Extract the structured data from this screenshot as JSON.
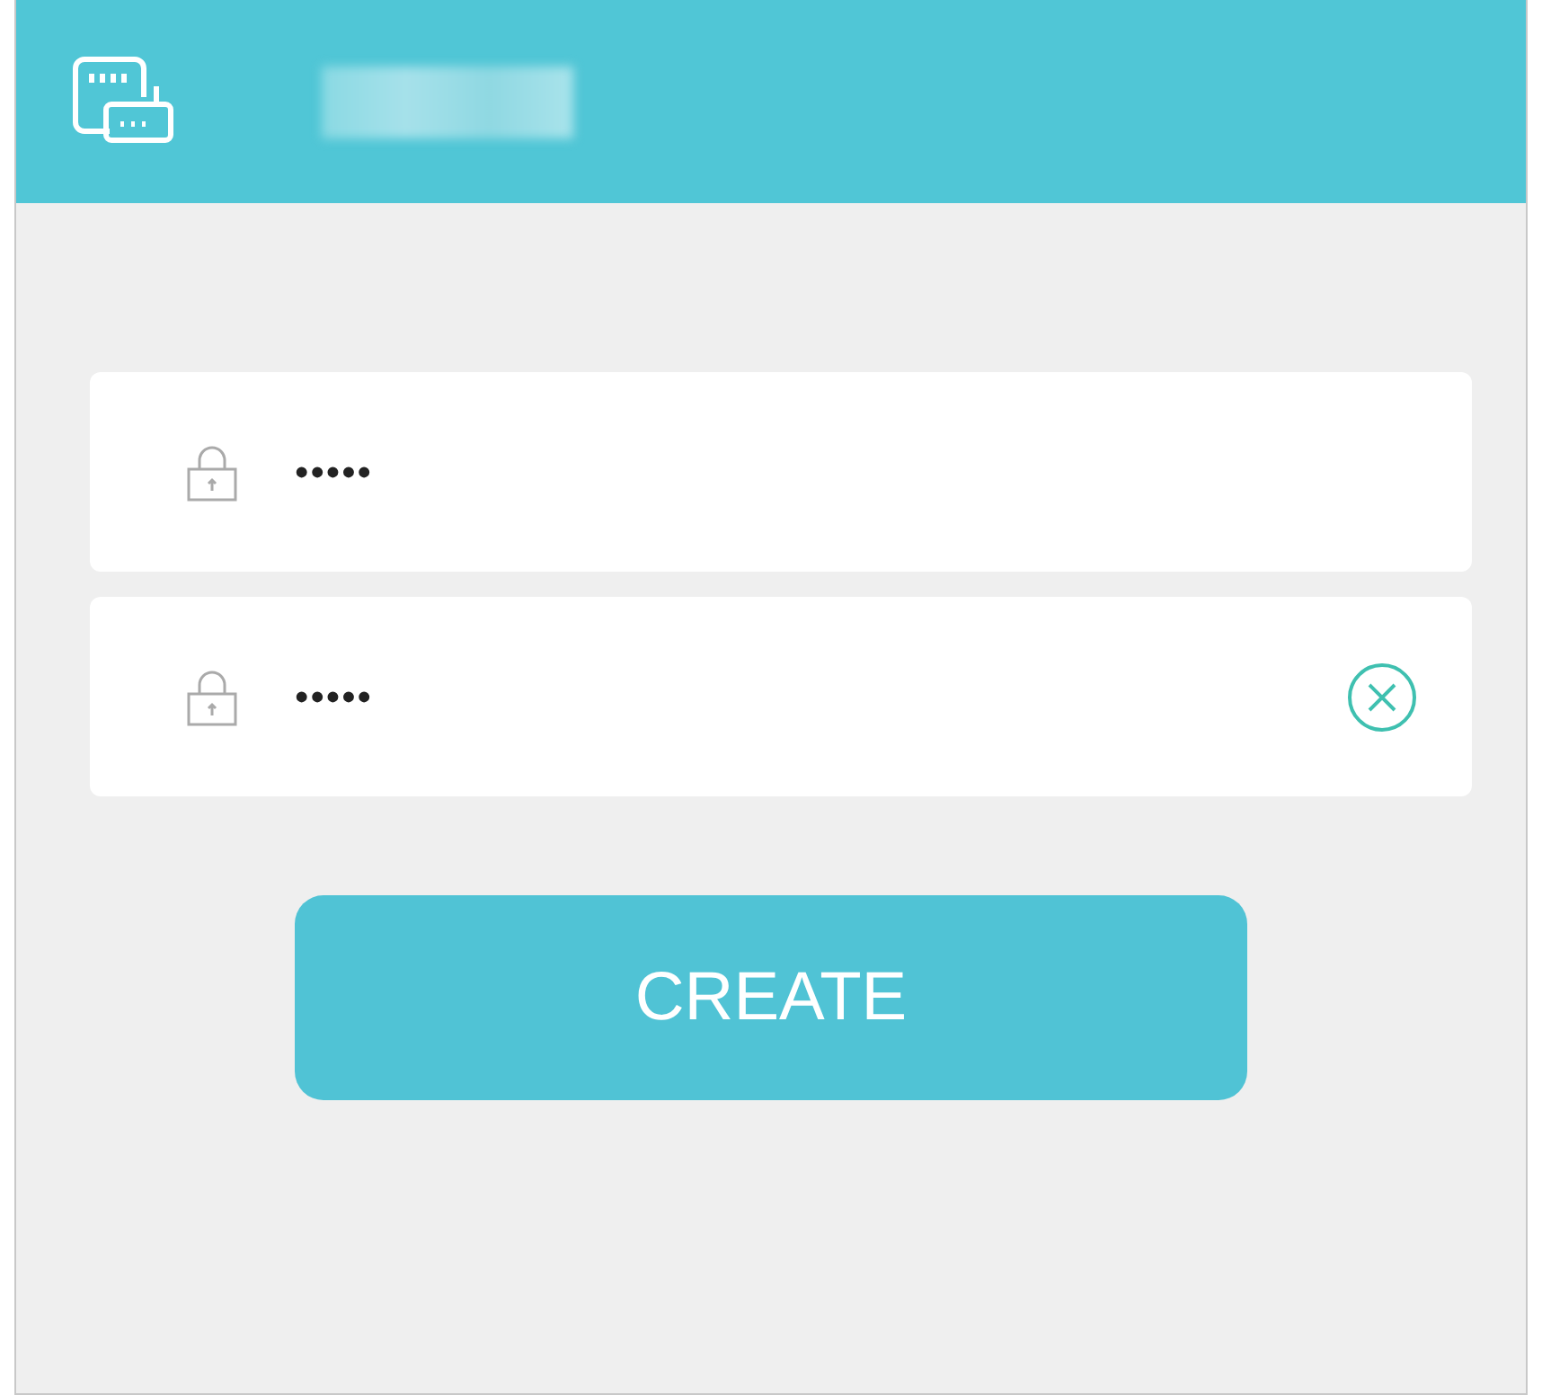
{
  "fields": [
    {
      "value": "•••••",
      "clear_button": false
    },
    {
      "value": "•••••",
      "clear_button": true
    }
  ],
  "button": {
    "label": "CREATE"
  }
}
